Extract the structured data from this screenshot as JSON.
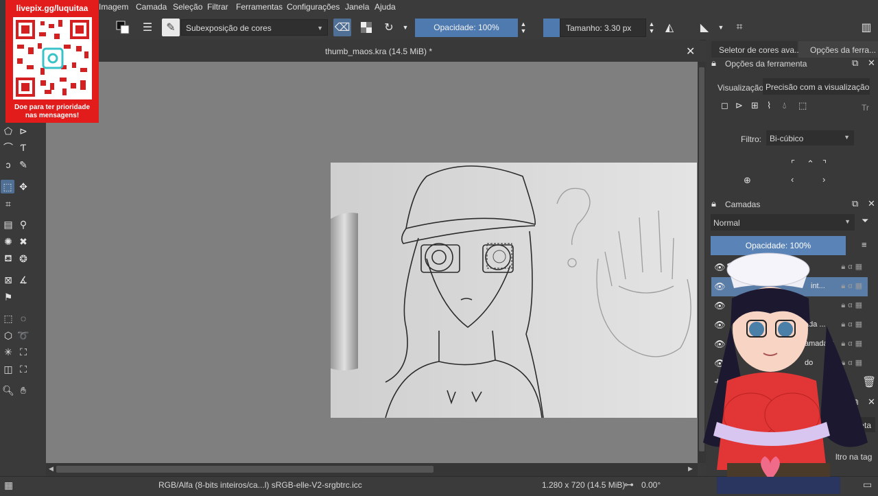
{
  "menubar": {
    "items": [
      {
        "label": "Imagem"
      },
      {
        "label": "Camada"
      },
      {
        "label": "Seleção"
      },
      {
        "label": "Filtrar"
      },
      {
        "label": "Ferramentas"
      },
      {
        "label": "Configurações"
      },
      {
        "label": "Janela"
      },
      {
        "label": "Ajuda"
      }
    ]
  },
  "toolbar": {
    "blend_mode": "Subexposição de cores",
    "opacity": "Opacidade: 100%",
    "size": "Tamanho: 3.30 px"
  },
  "canvas": {
    "document_title": "thumb_maos.kra (14.5 MiB) *"
  },
  "docker": {
    "tabs": [
      {
        "label": "Seletor de cores ava..."
      },
      {
        "label": "Opções da ferra..."
      }
    ],
    "tool_options": {
      "title": "Opções da ferramenta",
      "preview_label": "Visualização",
      "preview_value": "Precisão com a visualização inst",
      "truncated_label": "Tr",
      "filter_label": "Filtro:",
      "filter_value": "Bi-cúbico"
    },
    "layers": {
      "title": "Camadas",
      "blend_mode": "Normal",
      "opacity": "Opacidade:  100%",
      "rows": [
        {
          "name": ""
        },
        {
          "name": "int..."
        },
        {
          "name": ""
        },
        {
          "name": "ada ..."
        },
        {
          "name": "amada 3"
        },
        {
          "name": "do"
        }
      ]
    },
    "tags": {
      "label": "Etiqueta",
      "filter_text": "ltro na tag"
    }
  },
  "statusbar": {
    "color_info": "RGB/Alfa (8-bits inteiros/ca...l)  sRGB-elle-V2-srgbtrc.icc",
    "dimensions": "1.280 x 720 (14.5 MiB)",
    "rotation": "0.00°"
  },
  "overlay": {
    "url": "livepix.gg/luquitaa",
    "caption_line1": "Doe para ter prioridade",
    "caption_line2": "nas mensagens!"
  },
  "colors": {
    "accent": "#4f7ab0",
    "promo_red": "#e21b1b",
    "canvas_bg": "#7f7f7f"
  }
}
